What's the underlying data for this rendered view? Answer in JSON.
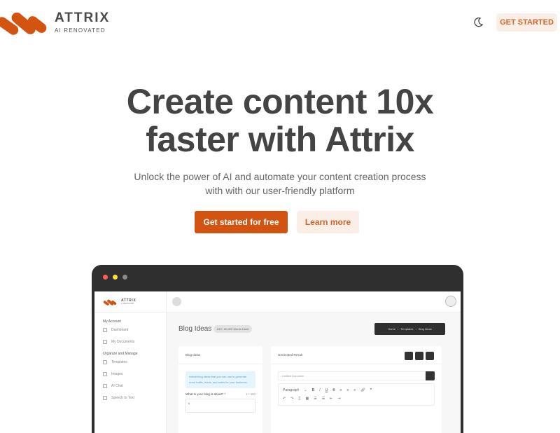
{
  "brand": {
    "name": "ATTRIX",
    "tagline": "AI RENOVATED",
    "accent": "#d35410",
    "accent_light": "#fbeee6"
  },
  "nav": {
    "theme_toggle_icon": "moon-icon",
    "cta_label": "GET STARTED"
  },
  "hero": {
    "title_line1": "Create content 10x",
    "title_line2": "faster with Attrix",
    "subtitle": "Unlock the power of AI and automate your content creation process with with our user-friendly platform",
    "primary_button": "Get started for free",
    "secondary_button": "Learn more"
  },
  "preview": {
    "window_dots": [
      "#ff5f56",
      "#ffdd3c",
      "#8a8a8a"
    ],
    "sidebar": {
      "logo_title": "ATTRIX",
      "logo_sub": "AI RENOVATED",
      "section1": "My Account",
      "items1": [
        {
          "label": "Dashboard",
          "icon": "dashboard-icon"
        },
        {
          "label": "My Documents",
          "icon": "document-icon"
        }
      ],
      "section2": "Organize and Manage",
      "items2": [
        {
          "label": "Templates",
          "icon": "layers-icon"
        },
        {
          "label": "Images",
          "icon": "image-icon"
        },
        {
          "label": "AI Chat",
          "icon": "chat-icon"
        },
        {
          "label": "Speech to Text",
          "icon": "headphones-icon"
        }
      ]
    },
    "page_title": "Blog Ideas",
    "words_used": "649 / 50,000 Words Used",
    "breadcrumb": [
      "Home",
      "Templates",
      "Blog Ideas"
    ],
    "left_card": {
      "title": "Blog Ideas",
      "info": "Article/blog ideas that you can use to generate more traffic, leads, and sales for your business.",
      "question": "What is your blog is about? *",
      "counter": "1 / 400",
      "input_value": "s"
    },
    "right_card": {
      "title": "Generated Result",
      "doc_placeholder": "Untitled Document",
      "format_select": "Paragraph"
    }
  }
}
